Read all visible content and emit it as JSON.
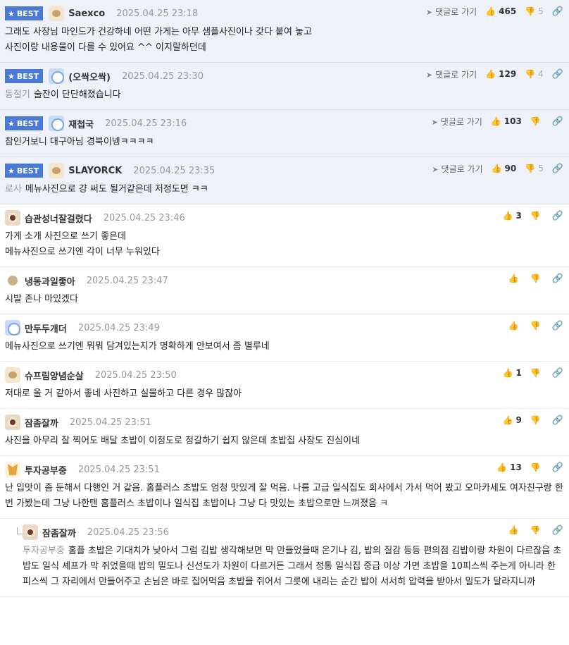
{
  "ui": {
    "best_label": "BEST",
    "reply_link_label": "댓글로 가기"
  },
  "comments": [
    {
      "best": true,
      "avatar": "puppy-avatar",
      "nick": "Saexco",
      "date": "2025.04.25 23:18",
      "up": "465",
      "down": "5",
      "mention": "",
      "text": "그래도 사장님 마인드가 건강하네 어떤 가게는 아무 샘플사진이나 갖다 붙여 놓고\n사진이랑 내용물이 다를 수 있어요 ^^ 이지랄하던데"
    },
    {
      "best": true,
      "avatar": "blue-ghost-avatar",
      "nick": "(오싹오싹)",
      "date": "2025.04.25 23:30",
      "up": "129",
      "down": "4",
      "mention": "동절기",
      "text": "술잔이 단단해졌습니다"
    },
    {
      "best": true,
      "avatar": "blue-ghost-avatar",
      "nick": "재첩국",
      "date": "2025.04.25 23:16",
      "up": "103",
      "down": "",
      "mention": "",
      "text": "참인거보니 대구아님 경북이넹ㅋㅋㅋㅋ"
    },
    {
      "best": true,
      "avatar": "puppy-avatar",
      "nick": "SLAYORCK",
      "date": "2025.04.25 23:35",
      "up": "90",
      "down": "5",
      "mention": "로사",
      "text": "메뉴사진으로 걍 써도 될거같은데 저정도면 ㅋㅋ"
    },
    {
      "best": false,
      "avatar": "lion-avatar",
      "nick": "습관성너잘걸렸다",
      "date": "2025.04.25 23:46",
      "up": "3",
      "down": "",
      "mention": "",
      "text": "가게 소개 사진으로 쓰기 좋은데\n메뉴사진으로 쓰기엔 각이 너무 누워있다"
    },
    {
      "best": false,
      "avatar": "brown-dot-avatar",
      "nick": "냉동과일좋아",
      "date": "2025.04.25 23:47",
      "up": "",
      "down": "",
      "mention": "",
      "text": "시발 존나 마있겠다"
    },
    {
      "best": false,
      "avatar": "blue-ghost-avatar",
      "nick": "만두두개더",
      "date": "2025.04.25 23:49",
      "up": "",
      "down": "",
      "mention": "",
      "text": "메뉴사진으로 쓰기엔 뭐뭐 담겨있는지가 명확하게 안보여서 좀 별루네"
    },
    {
      "best": false,
      "avatar": "puppy-avatar",
      "nick": "슈프림양념순살",
      "date": "2025.04.25 23:50",
      "up": "1",
      "down": "",
      "mention": "",
      "text": "저대로 올 거 같아서 좋네 사진하고 실물하고 다른 경우 많잖아"
    },
    {
      "best": false,
      "avatar": "lion-avatar",
      "nick": "잠좀잘까",
      "date": "2025.04.25 23:51",
      "up": "9",
      "down": "",
      "mention": "",
      "text": "사진을 아무리 잘 찍어도 배달 초밥이 이정도로 정갈하기 쉽지 않은데 초밥집 사장도 진심이네"
    },
    {
      "best": false,
      "avatar": "fox-avatar",
      "nick": "투자공부중",
      "date": "2025.04.25 23:51",
      "up": "13",
      "down": "",
      "mention": "",
      "text": "난 입맛이 좀 둔해서 다행인 거 같음. 홈플러스 초밥도 엄청 맛있게 잘 먹음. 나름 고급 일식집도 회사에서 가서 먹어 봤고 오마카세도 여자친구랑 한 번 가봤는데 그냥 나한텐 홈플러스 초밥이나 일식집 초밥이나 그냥 다 맛있는 초밥으로만 느껴졌음 ㅋ"
    },
    {
      "best": false,
      "reply": true,
      "avatar": "lion-avatar",
      "nick": "잠좀잘까",
      "date": "2025.04.25 23:56",
      "up": "",
      "down": "",
      "mention": "투자공부중",
      "text": "홈플 초밥은 기대치가 낮아서 그럼 김밥 생각해보면 막 만들었을때 온기나 김, 밥의 질감 등등 편의점 김밥이랑 차원이 다르잖음 초밥도 일식 셰프가 막 쥐었을때 밥의 밀도나 신선도가 차원이 다르거든 그래서 정통 일식집 중급 이상 가면 초밥을 10피스씩 주는게 아니라 한피스씩 그 자리에서 만들어주고 손님은 바로 집어먹음 초밥을 쥐어서 그릇에 내리는 순간 밥이 서서히 압력을 받아서 밀도가 달라지니까"
    }
  ]
}
